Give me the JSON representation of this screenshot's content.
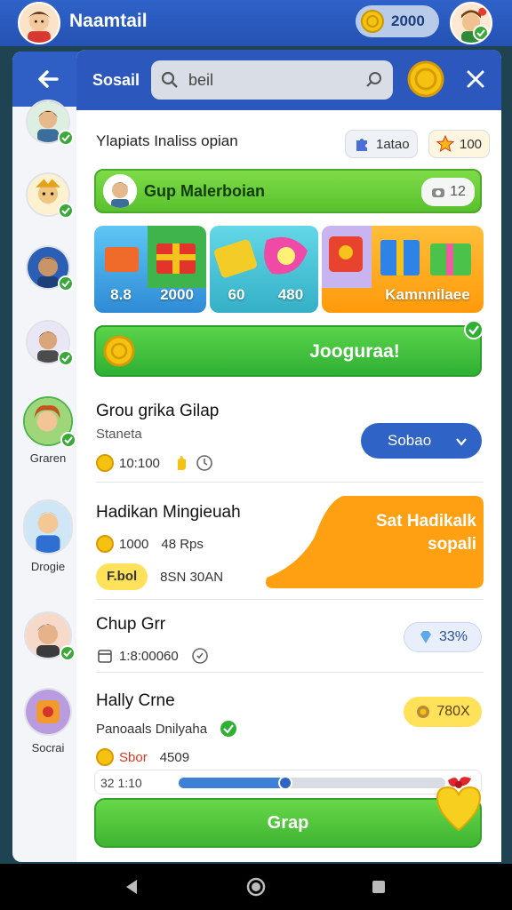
{
  "topbar": {
    "username": "Naamtail",
    "coins": "2000"
  },
  "sidebar": {
    "items": [
      {
        "label": ""
      },
      {
        "label": ""
      },
      {
        "label": ""
      },
      {
        "label": ""
      },
      {
        "label": "Graren"
      },
      {
        "label": "Drogie"
      },
      {
        "label": ""
      },
      {
        "label": "Socrai"
      }
    ]
  },
  "panel": {
    "title": "Sosail",
    "search_value": "beil",
    "section_title": "Ylapiats Inaliss opian",
    "chip_a": "1atao",
    "chip_b": "100",
    "group_bar": {
      "title": "Gup Malerboian",
      "count": "12"
    },
    "cards": [
      {
        "label": "8.8"
      },
      {
        "label": "2000"
      },
      {
        "label": "60"
      },
      {
        "label": "480"
      },
      {
        "label": "Kamnnilaee"
      }
    ],
    "join_label": "Jooguraa!",
    "groups": [
      {
        "title": "Grou grika Gilap",
        "sub": "Staneta",
        "coins": "10:100",
        "select": "Sobao"
      },
      {
        "title": "Hadikan Mingieuah",
        "coins": "1000",
        "stat": "48 Rps",
        "pill": "F.bol",
        "extra": "8SN 30AN",
        "action_line1": "Sat Hadikalk",
        "action_line2": "sopali"
      },
      {
        "title": "Chup Grr",
        "time": "1:8:00060",
        "pct": "33%"
      },
      {
        "title": "Hally Crne",
        "sub": "Panoaals Dnilyaha",
        "pill_label": "Sbor",
        "stat": "4509",
        "pct": "780X"
      }
    ],
    "progress": {
      "label": "32 1:10",
      "value": 0.4
    },
    "main_button": "Grap"
  },
  "colors": {
    "accent": "#2f63c6",
    "green": "#58c12d",
    "orange": "#ff9a0a",
    "coin": "#f5c211"
  }
}
